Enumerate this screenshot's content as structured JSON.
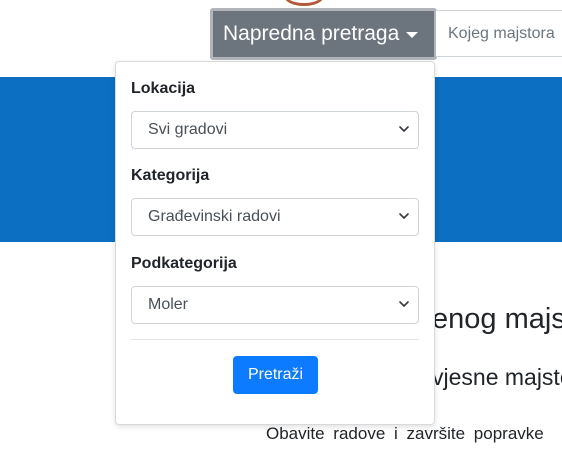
{
  "header": {
    "advanced_search_label": "Napredna pretraga",
    "search_placeholder": "Kojeg majstora"
  },
  "dropdown": {
    "location_label": "Lokacija",
    "location_value": "Svi gradovi",
    "category_label": "Kategorija",
    "category_value": "Građevinski radovi",
    "subcategory_label": "Podkategorija",
    "subcategory_value": "Moler",
    "search_button_label": "Pretraži"
  },
  "page": {
    "heading_partial": "enog majs",
    "subheading_partial": "vjesne majsto",
    "paragraph_partial": "Obavite radove i završite popravke"
  },
  "colors": {
    "brand_blue": "#0c6fc2",
    "button_gray": "#6c757d",
    "primary": "#0d7bff"
  }
}
